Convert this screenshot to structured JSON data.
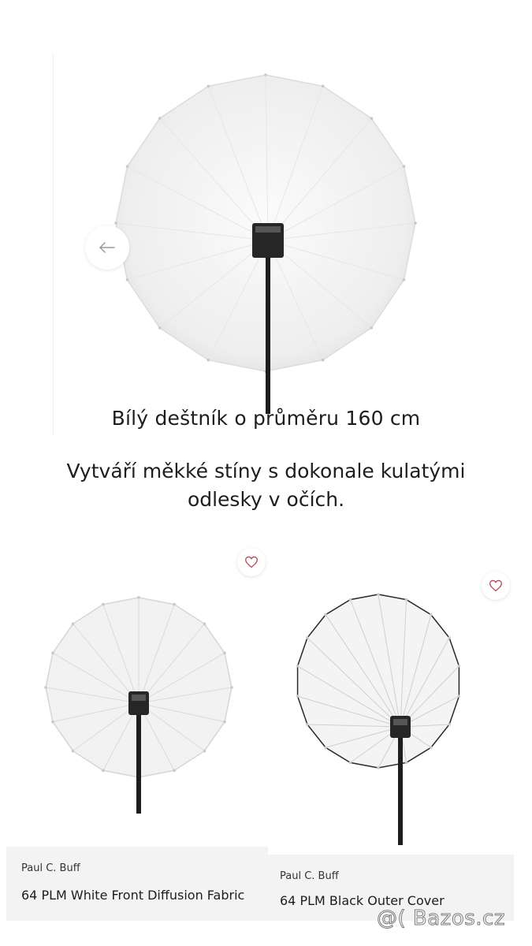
{
  "hero": {
    "title": "Bílý deštník o průměru 160 cm",
    "description": "Vytváří měkké stíny s dokonale kulatými odlesky v očích.",
    "prev_icon": "arrow-left-icon"
  },
  "products": [
    {
      "brand": "Paul C. Buff",
      "name": "64 PLM White Front Diffusion Fabric",
      "fav_icon": "heart-outline-icon"
    },
    {
      "brand": "Paul C. Buff",
      "name": "64 PLM Black Outer Cover",
      "fav_icon": "heart-outline-icon"
    }
  ],
  "watermark": "@( Bazos.cz",
  "colors": {
    "accent_heart": "#b7475d",
    "info_bg": "#f3f3f3"
  }
}
